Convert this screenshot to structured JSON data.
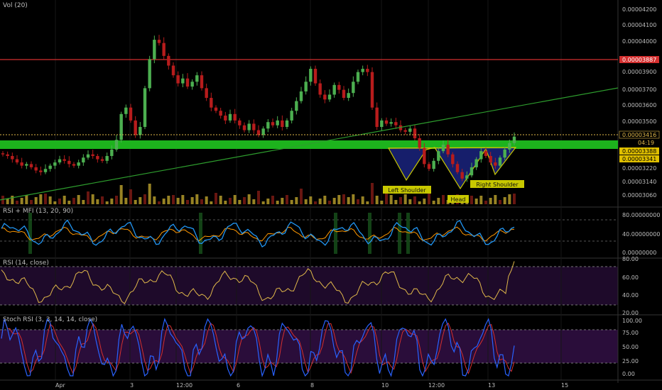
{
  "colors": {
    "background": "#000000",
    "candle_up": "#4caf50",
    "candle_down": "#b71c1c",
    "resistance_line": "#d32f2f",
    "support_zone": "#1db31d",
    "trend_line": "#2e9e2e",
    "pattern_outline": "#c8c800",
    "pattern_fill": "#1a237e",
    "rsi_mfi_blue": "#2196f3",
    "rsi_mfi_orange": "#ff9800",
    "rsi_line": "#e0b84a",
    "stoch_k": "#2962ff",
    "stoch_d": "#d32f2f",
    "pane_bg": "#1e0a2a"
  },
  "panes": {
    "price": {
      "label": "Vol (20)"
    },
    "rsi_mfi": {
      "label": "RSI + MFI (13, 20, 90)"
    },
    "rsi": {
      "label": "RSI (14, close)"
    },
    "stoch": {
      "label": "Stoch RSI (3, 3, 14, 14, close)"
    }
  },
  "price_axis": [
    "0.00004200",
    "0.00004100",
    "0.00004000",
    "0.00003900",
    "0.00003700",
    "0.00003600",
    "0.00003500",
    "0.00003220",
    "0.00003140",
    "0.00003060"
  ],
  "price_tags": {
    "resistance": "0.00003887",
    "current": "0.00003416",
    "timer": "04:19",
    "zone_top": "0.00003388",
    "zone_bottom": "0.00003341"
  },
  "rsi_mfi_axis": [
    "80.00000000",
    "40.00000000",
    "0.00000000"
  ],
  "rsi_axis": [
    "80.00",
    "60.00",
    "40.00",
    "20.00"
  ],
  "stoch_axis": [
    "100.00",
    "75.00",
    "50.00",
    "25.00",
    "0.00"
  ],
  "time_axis": [
    "Apr",
    "3",
    "12:00",
    "6",
    "8",
    "10",
    "12:00",
    "13",
    "15"
  ],
  "pattern_labels": {
    "left_shoulder": "Left Shoulder",
    "head": "Head",
    "right_shoulder": "Right Shoulder"
  },
  "chart_data": {
    "type": "candlestick",
    "ylim": [
      3.01e-05,
      4.24e-05
    ],
    "levels": {
      "resistance": 3.887e-05,
      "current": 3.416e-05,
      "zone_top": 3.388e-05,
      "zone_bottom": 3.341e-05
    },
    "candles_close_approx": [
      3.31e-05,
      3.3e-05,
      3.28e-05,
      3.26e-05,
      3.24e-05,
      3.25e-05,
      3.23e-05,
      3.21e-05,
      3.2e-05,
      3.22e-05,
      3.24e-05,
      3.26e-05,
      3.28e-05,
      3.27e-05,
      3.25e-05,
      3.24e-05,
      3.26e-05,
      3.29e-05,
      3.31e-05,
      3.3e-05,
      3.28e-05,
      3.27e-05,
      3.3e-05,
      3.34e-05,
      3.4e-05,
      3.56e-05,
      3.6e-05,
      3.52e-05,
      3.43e-05,
      3.48e-05,
      3.72e-05,
      3.9e-05,
      4.02e-05,
      4e-05,
      3.92e-05,
      3.86e-05,
      3.8e-05,
      3.75e-05,
      3.78e-05,
      3.73e-05,
      3.76e-05,
      3.8e-05,
      3.72e-05,
      3.66e-05,
      3.6e-05,
      3.58e-05,
      3.55e-05,
      3.52e-05,
      3.56e-05,
      3.52e-05,
      3.49e-05,
      3.46e-05,
      3.5e-05,
      3.46e-05,
      3.43e-05,
      3.47e-05,
      3.51e-05,
      3.49e-05,
      3.52e-05,
      3.48e-05,
      3.52e-05,
      3.58e-05,
      3.64e-05,
      3.7e-05,
      3.76e-05,
      3.84e-05,
      3.75e-05,
      3.68e-05,
      3.65e-05,
      3.68e-05,
      3.74e-05,
      3.71e-05,
      3.66e-05,
      3.69e-05,
      3.76e-05,
      3.82e-05,
      3.84e-05,
      3.82e-05,
      3.6e-05,
      3.48e-05,
      3.52e-05,
      3.5e-05,
      3.51e-05,
      3.49e-05,
      3.46e-05,
      3.45e-05,
      3.47e-05,
      3.41e-05,
      3.35e-05,
      3.25e-05,
      3.22e-05,
      3.27e-05,
      3.33e-05,
      3.37e-05,
      3.31e-05,
      3.25e-05,
      3.2e-05,
      3.16e-05,
      3.18e-05,
      3.23e-05,
      3.28e-05,
      3.33e-05,
      3.3e-05,
      3.26e-05,
      3.24e-05,
      3.29e-05,
      3.34e-05,
      3.38e-05,
      3.42e-05
    ],
    "x_ticks": [
      "Apr",
      "3",
      "12:00",
      "6",
      "8",
      "10",
      "12:00",
      "13",
      "15"
    ]
  }
}
